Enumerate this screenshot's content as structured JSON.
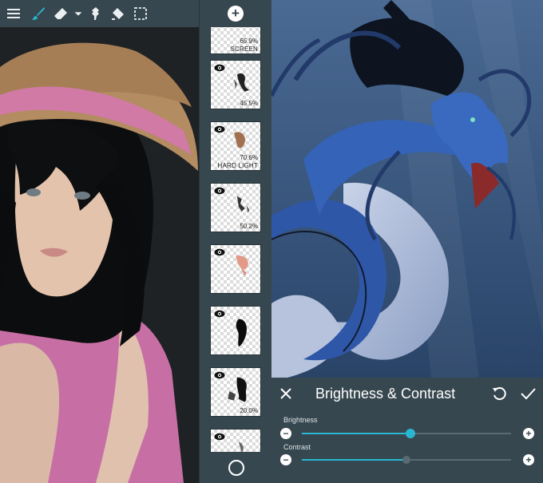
{
  "layers_panel": {
    "layers": [
      {
        "opacity": "65.9%",
        "mode": "SCREEN"
      },
      {
        "opacity": "45.5%",
        "mode": ""
      },
      {
        "opacity": "70.6%",
        "mode": "HARD LIGHT"
      },
      {
        "opacity": "50.2%",
        "mode": ""
      },
      {
        "opacity": "",
        "mode": ""
      },
      {
        "opacity": "",
        "mode": ""
      },
      {
        "opacity": "20.0%",
        "mode": ""
      },
      {
        "opacity": "",
        "mode": ""
      }
    ]
  },
  "toolbar": {
    "icons": [
      "menu-icon",
      "brush-icon",
      "eraser-icon",
      "dropdown-icon",
      "smudge-icon",
      "fill-icon",
      "selection-icon"
    ]
  },
  "adjustment": {
    "title": "Brightness & Contrast",
    "brightness_label": "Brightness",
    "contrast_label": "Contrast",
    "brightness_value": 0.52,
    "contrast_value": 0.5
  },
  "colors": {
    "accent": "#29b6d2",
    "panel": "#37474f"
  }
}
